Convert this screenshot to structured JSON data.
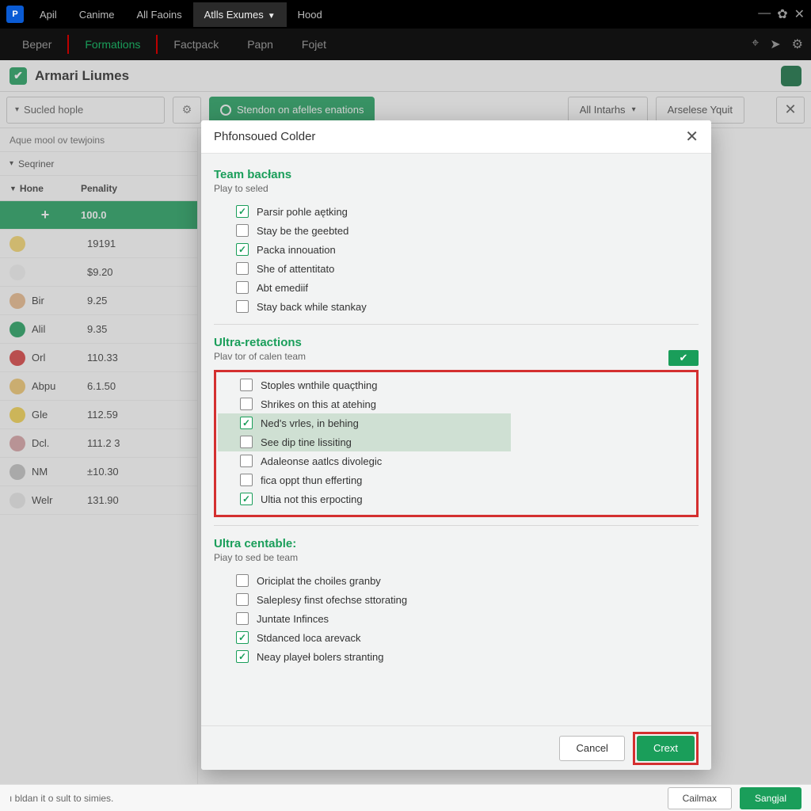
{
  "window": {
    "app_icon_text": "P",
    "tabs": [
      "Apil",
      "Canime",
      "All Faoins",
      "Atlls Exumes",
      "Hood"
    ],
    "active_tab_idx": 3,
    "controls": {
      "min": "—",
      "gear": "✿",
      "close": "✕"
    }
  },
  "nav": {
    "items": [
      "Beper",
      "Formations",
      "Factpack",
      "Papn",
      "Fojet"
    ],
    "active_idx": 1,
    "icons": {
      "target": "⌖",
      "plane": "➤",
      "gear2": "⚙"
    }
  },
  "header": {
    "check_glyph": "✔",
    "title": "Armari Liumes"
  },
  "toolbar": {
    "filter_placeholder": "Sucled hople",
    "gear_glyph": "⚙",
    "green_btn": "Stendon on afelles enations",
    "dd1": "All Intarhs",
    "dd2": "Arselese Yquit",
    "close_glyph": "✕"
  },
  "table": {
    "subhead": "Aque mool ov tewjoins",
    "section": "Seqriner",
    "col1": "Hone",
    "col2": "Penality",
    "rows": [
      {
        "avatar_color": "#1a9e5a",
        "name": "+",
        "val": "100.0",
        "highlight": true,
        "plus": true
      },
      {
        "avatar_color": "#f6d66a",
        "name": "",
        "val": "19191"
      },
      {
        "avatar_color": "#f4f4f4",
        "name": "",
        "val": "$9.20"
      },
      {
        "avatar_color": "#e9b98a",
        "name": "Bir",
        "val": "9.25"
      },
      {
        "avatar_color": "#1a9e5a",
        "name": "Alil",
        "val": "9.35"
      },
      {
        "avatar_color": "#d83a3a",
        "name": "Orl",
        "val": "110.33"
      },
      {
        "avatar_color": "#f1c66c",
        "name": "Abpu",
        "val": "6.1.50"
      },
      {
        "avatar_color": "#f4d24a",
        "name": "Gle",
        "val": "112.59"
      },
      {
        "avatar_color": "#d69fa2",
        "name": "Dcl.",
        "val": "111.2 3"
      },
      {
        "avatar_color": "#c0c0c0",
        "name": "NM",
        "val": "±10.30"
      },
      {
        "avatar_color": "#e9e9e9",
        "name": "Welr",
        "val": "131.90"
      }
    ]
  },
  "modal": {
    "title": "Phfonsoued Colder",
    "close_glyph": "✕",
    "sections": [
      {
        "title": "Team bacłans",
        "sub": "Play to seled",
        "options": [
          {
            "label": "Parsir pohle aętking",
            "checked": true
          },
          {
            "label": "Stay be the geebted",
            "checked": false
          },
          {
            "label": "Packa innouation",
            "checked": true
          },
          {
            "label": "She of attentitato",
            "checked": false
          },
          {
            "label": "Abt emediif",
            "checked": false
          },
          {
            "label": "Stay back while stankay",
            "checked": false
          }
        ],
        "toggle_glyph": "✔"
      },
      {
        "title": "Ultra-retactions",
        "sub": "Plav tor of calen team",
        "red_box": true,
        "options": [
          {
            "label": "Stoples wnthile quaçthing",
            "checked": false
          },
          {
            "label": "Shrikes on this at atehing",
            "checked": false
          },
          {
            "label": "Ned's vrles, in behing",
            "checked": true,
            "hl": true
          },
          {
            "label": "See dip tine lissiting",
            "checked": false,
            "hl": true
          },
          {
            "label": "Adaleonse aatlcs divolegic",
            "checked": false
          },
          {
            "label": "fica oppt thun efferting",
            "checked": false
          },
          {
            "label": "Ultia not this erpocting",
            "checked": true
          }
        ]
      },
      {
        "title": "Ultra centable:",
        "sub": "Piay to sed be team",
        "options": [
          {
            "label": "Oriciplat the choiles granby",
            "checked": false
          },
          {
            "label": "Saleplesy finst ofechse sttorating",
            "checked": false
          },
          {
            "label": "Juntate Infinces",
            "checked": false
          },
          {
            "label": "Stdanced loca arevack",
            "checked": true
          },
          {
            "label": "Neay playeł bolers stranting",
            "checked": true
          }
        ]
      }
    ],
    "footer": {
      "cancel": "Cancel",
      "create": "Crext"
    }
  },
  "status": {
    "text": "ı bldan it o sult to simies.",
    "btn1": "Cailmax",
    "btn2": "Sangjal"
  }
}
